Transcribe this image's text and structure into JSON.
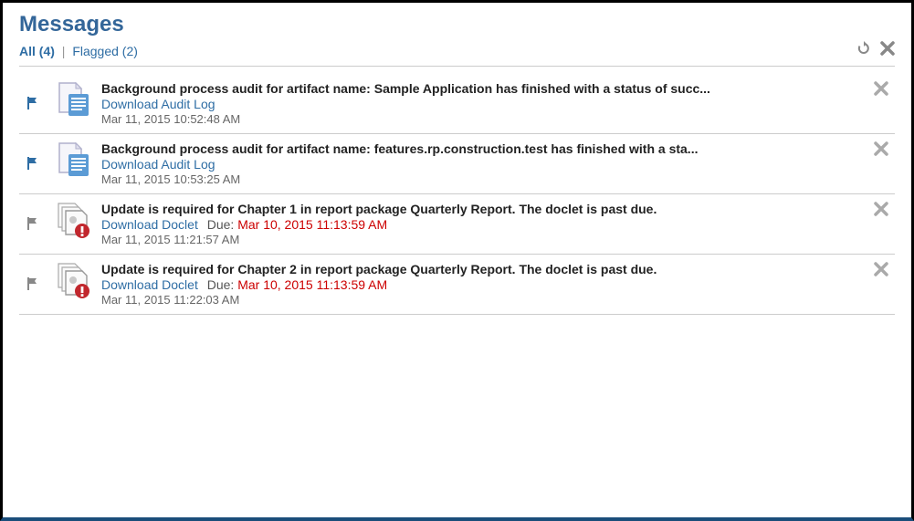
{
  "title": "Messages",
  "tabs": {
    "all": "All (4)",
    "flagged": "Flagged (2)"
  },
  "messages": [
    {
      "flagged": true,
      "iconType": "doc",
      "title": "Background process audit for artifact name: Sample Application has finished with a status of succ...",
      "link": "Download Audit Log",
      "dueLabel": "",
      "dueDate": "",
      "timestamp": "Mar 11, 2015 10:52:48 AM"
    },
    {
      "flagged": true,
      "iconType": "doc",
      "title": "Background process audit for artifact name: features.rp.construction.test has finished with a sta...",
      "link": "Download Audit Log",
      "dueLabel": "",
      "dueDate": "",
      "timestamp": "Mar 11, 2015 10:53:25 AM"
    },
    {
      "flagged": false,
      "iconType": "stack",
      "title": "Update is required for Chapter 1 in report package Quarterly Report. The doclet is past due.",
      "link": "Download Doclet",
      "dueLabel": "Due:",
      "dueDate": "Mar 10, 2015 11:13:59 AM",
      "timestamp": "Mar 11, 2015 11:21:57 AM"
    },
    {
      "flagged": false,
      "iconType": "stack",
      "title": "Update is required for Chapter 2 in report package Quarterly Report. The doclet is past due.",
      "link": "Download Doclet",
      "dueLabel": "Due:",
      "dueDate": "Mar 10, 2015 11:13:59 AM",
      "timestamp": "Mar 11, 2015 11:22:03 AM"
    }
  ]
}
